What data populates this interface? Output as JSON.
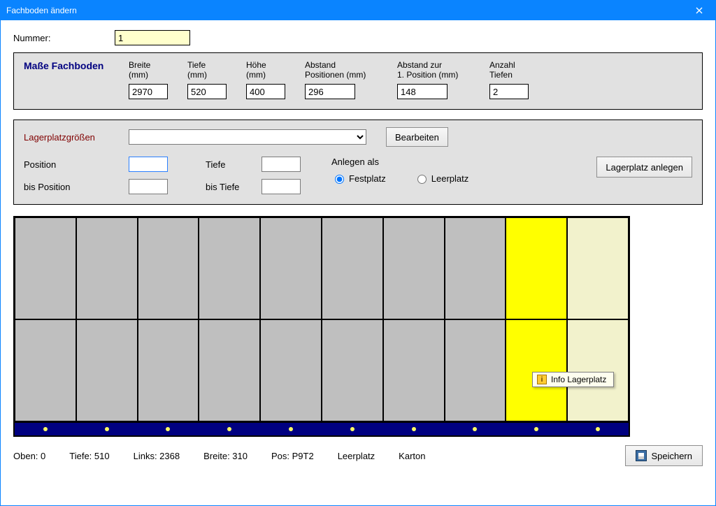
{
  "window": {
    "title": "Fachboden ändern"
  },
  "number": {
    "label": "Nummer:",
    "value": "1"
  },
  "masse": {
    "title": "Maße Fachboden",
    "cols": {
      "breite": {
        "label": "Breite\n(mm)",
        "value": "2970"
      },
      "tiefe": {
        "label": "Tiefe\n(mm)",
        "value": "520"
      },
      "hoehe": {
        "label": "Höhe\n(mm)",
        "value": "400"
      },
      "abstand_pos": {
        "label": "Abstand\nPositionen (mm)",
        "value": "296"
      },
      "abstand_first": {
        "label": "Abstand zur\n1. Position (mm)",
        "value": "148"
      },
      "anzahl_tiefen": {
        "label": "Anzahl\nTiefen",
        "value": "2"
      }
    }
  },
  "sizes": {
    "label": "Lagerplatzgrößen",
    "selected": "",
    "edit_label": "Bearbeiten"
  },
  "pos": {
    "position_label": "Position",
    "bis_position_label": "bis Position",
    "tiefe_label": "Tiefe",
    "bis_tiefe_label": "bis Tiefe",
    "position": "",
    "bis_position": "",
    "tiefe": "",
    "bis_tiefe": ""
  },
  "anlegen": {
    "label": "Anlegen als",
    "festplatz": "Festplatz",
    "leerplatz": "Leerplatz",
    "selected": "Festplatz",
    "create_label": "Lagerplatz anlegen"
  },
  "tooltip": {
    "text": "Info Lagerplatz"
  },
  "status": {
    "oben": "Oben: 0",
    "tiefe": "Tiefe: 510",
    "links": "Links: 2368",
    "breite": "Breite: 310",
    "pos": "Pos: P9T2",
    "leerplatz": "Leerplatz",
    "karton": "Karton"
  },
  "save": {
    "label": "Speichern"
  },
  "grid": {
    "rows": 2,
    "cols": 10,
    "special": {
      "yellow_col": 8,
      "pale_col": 9
    }
  }
}
